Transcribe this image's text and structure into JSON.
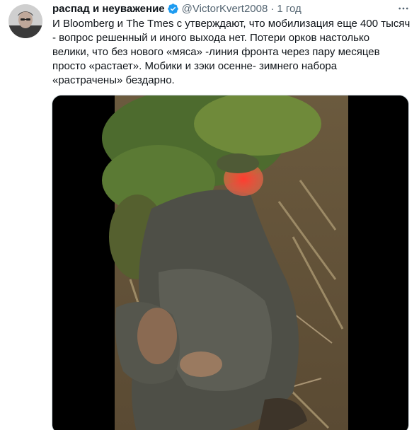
{
  "user": {
    "display_name": "распад и неуважение",
    "handle": "@VictorKvert2008",
    "separator": "·",
    "time": "1 год"
  },
  "tweet": {
    "lines": [
      "И Bloomberg  и The Tmes с утверждают, что мобилизация еще 400 тысяч",
      "- вопрос решенный и иного выхода нет. Потери орков настолько",
      "велики, что без нового «мяса» -линия фронта через пару месяцев",
      "просто «растает». Мобики  и зэки осенне- зимнего набора",
      "«растрачены» бездарно."
    ]
  },
  "icons": {
    "verified": "verified-badge-icon",
    "more": "more-options-icon"
  },
  "colors": {
    "accent": "#1d9bf0",
    "muted": "#536471",
    "text": "#0f1419"
  }
}
